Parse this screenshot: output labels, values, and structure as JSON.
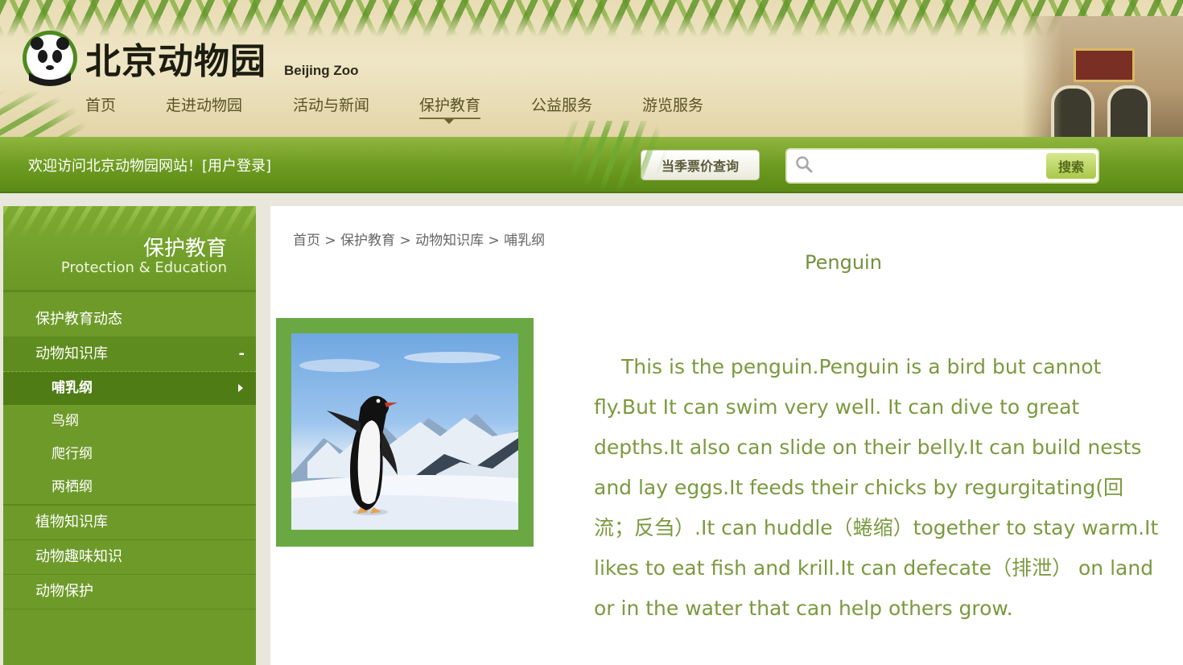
{
  "header": {
    "logo_cn": "北京动物园",
    "logo_en": "Beijing Zoo",
    "nav": [
      {
        "label": "首页"
      },
      {
        "label": "走进动物园"
      },
      {
        "label": "活动与新闻"
      },
      {
        "label": "保护教育",
        "active": true
      },
      {
        "label": "公益服务"
      },
      {
        "label": "游览服务"
      }
    ]
  },
  "topbar": {
    "welcome": "欢迎访问北京动物园网站！",
    "login": "[用户登录]",
    "ticket_button": "当季票价查询",
    "search_placeholder": "",
    "search_button": "搜索"
  },
  "sidebar": {
    "title_cn": "保护教育",
    "title_en": "Protection & Education",
    "menu": [
      {
        "label": "保护教育动态"
      },
      {
        "label": "动物知识库",
        "expanded": true,
        "toggle": "-"
      },
      {
        "label": "植物知识库"
      },
      {
        "label": "动物趣味知识"
      },
      {
        "label": "动物保护"
      }
    ],
    "submenu": [
      {
        "label": "哺乳纲",
        "active": true
      },
      {
        "label": "鸟纲"
      },
      {
        "label": "爬行纲"
      },
      {
        "label": "两栖纲"
      }
    ]
  },
  "content": {
    "breadcrumb": "首页 > 保护教育 > 动物知识库 > 哺乳纲",
    "title": "Penguin",
    "article": "This is the penguin.Penguin is a bird but cannot fly.But It can swim very well. It can dive to great depths.It also can slide on their belly.It can build nests and lay eggs.It feeds their chicks by regurgitating(回流；反刍）.It can huddle（蜷缩）together to stay warm.It likes to eat fish and krill.It can defecate（排泄） on land or in the water that can help others grow."
  },
  "colors": {
    "brand_green": "#6e9a2a",
    "text_green": "#7a9a3e",
    "photo_frame": "#6aa844"
  }
}
